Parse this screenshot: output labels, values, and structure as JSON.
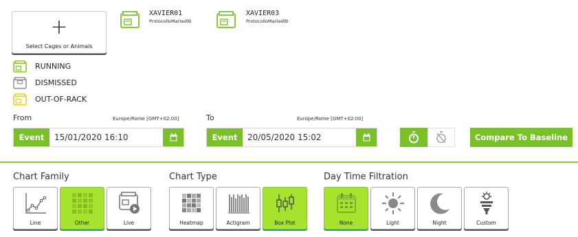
{
  "select_button": {
    "label": "Select Cages or Animals"
  },
  "cages": [
    {
      "name": "XAVIER01",
      "protocol": "ProtocolloMartedìB"
    },
    {
      "name": "XAVIER03",
      "protocol": "ProtocolloMartedìB"
    }
  ],
  "legend": [
    {
      "label": "RUNNING",
      "color": "#8cc63f",
      "icon": "cage-icon"
    },
    {
      "label": "DISMISSED",
      "color": "#9a9a9a",
      "icon": "cage-icon"
    },
    {
      "label": "OUT-OF-RACK",
      "color": "#e5d23a",
      "icon": "cage-icon"
    }
  ],
  "from": {
    "label": "From",
    "timezone": "Europe/Rome [GMT+02:00]",
    "mode": "Event",
    "value": "15/01/2020 16:10"
  },
  "to": {
    "label": "To",
    "timezone": "Europe/Rome [GMT+02:00]",
    "mode": "Event",
    "value": "20/05/2020 15:02"
  },
  "compare_button": {
    "label": "Compare To Baseline"
  },
  "chart_family": {
    "title": "Chart Family",
    "items": [
      {
        "label": "Line",
        "icon": "line-chart-icon",
        "active": false
      },
      {
        "label": "Other",
        "icon": "grid-icon",
        "active": true
      },
      {
        "label": "Live",
        "icon": "live-cage-icon",
        "active": false
      }
    ]
  },
  "chart_type": {
    "title": "Chart Type",
    "items": [
      {
        "label": "Heatmap",
        "icon": "heatmap-icon",
        "active": false
      },
      {
        "label": "Actigram",
        "icon": "actigram-icon",
        "active": false
      },
      {
        "label": "Box Plot",
        "icon": "box-plot-icon",
        "active": true
      }
    ]
  },
  "day_time": {
    "title": "Day Time Filtration",
    "items": [
      {
        "label": "None",
        "icon": "calendar-icon",
        "active": true
      },
      {
        "label": "Light",
        "icon": "sun-icon",
        "active": false
      },
      {
        "label": "Night",
        "icon": "moon-icon",
        "active": false
      },
      {
        "label": "Custom",
        "icon": "lamp-icon",
        "active": false
      }
    ]
  },
  "colors": {
    "accent": "#79c02b",
    "active_tile": "#a6e22e",
    "active_underline": "#1aa36b"
  }
}
